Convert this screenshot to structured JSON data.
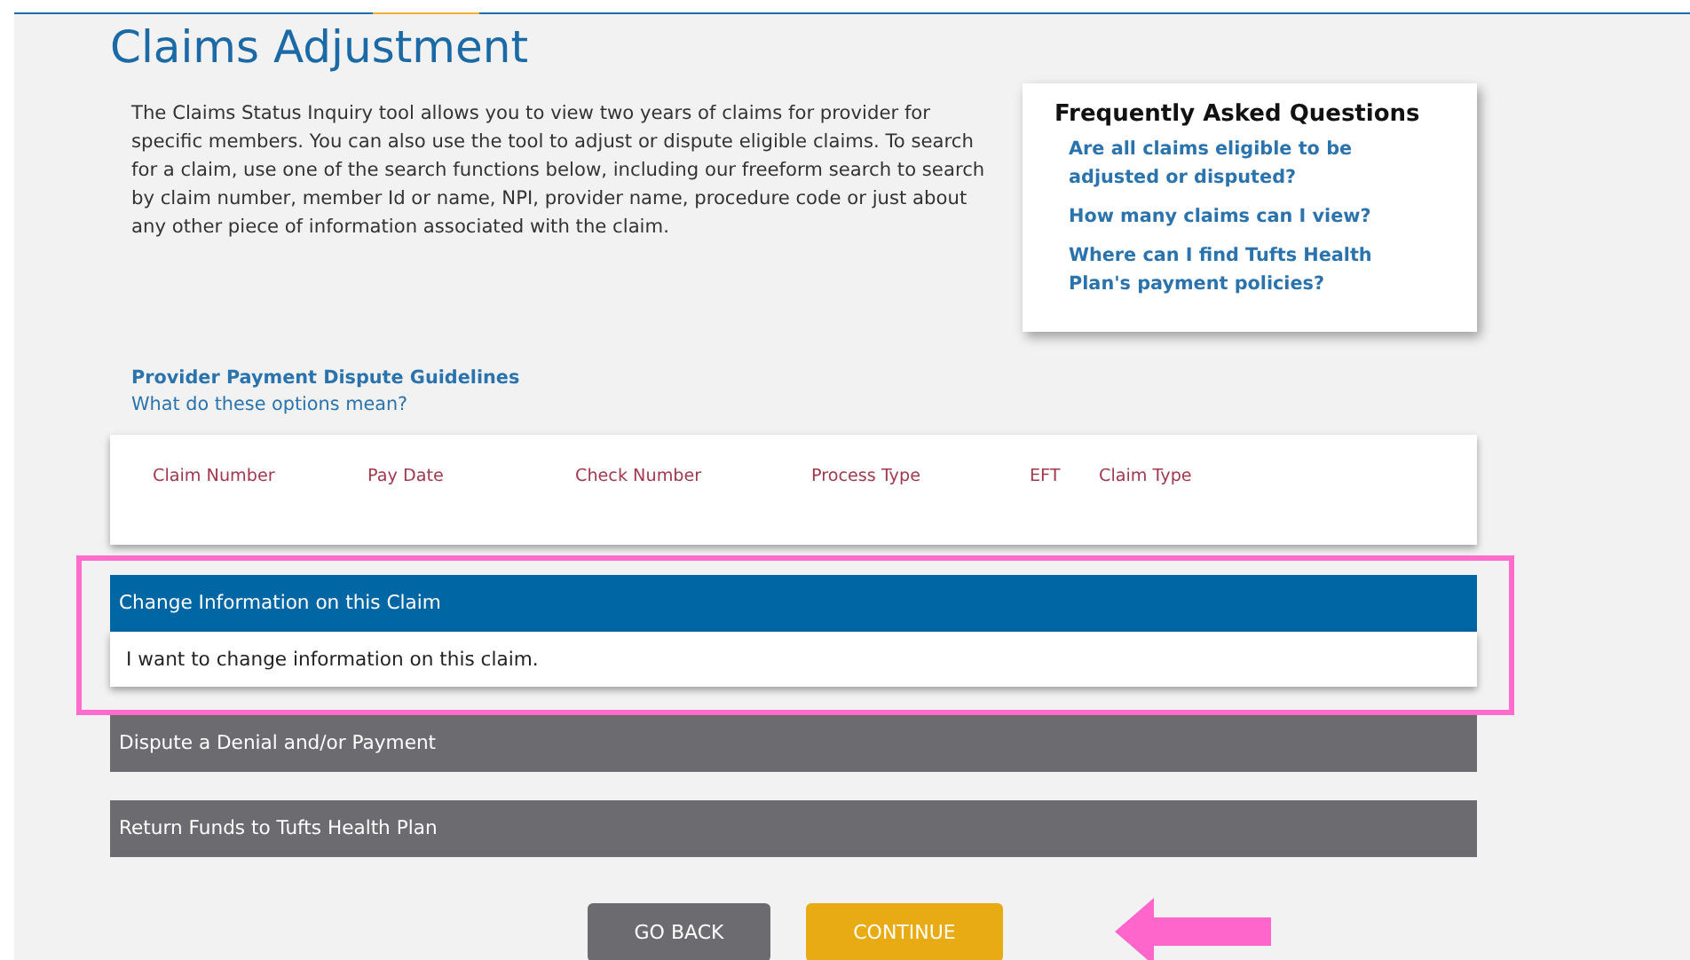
{
  "title": "Claims Adjustment",
  "intro": "The Claims Status Inquiry tool allows you to view two years of claims for provider for specific members. You can also use the tool to adjust or dispute eligible claims. To search for a claim, use one of the search functions below, including our freeform search to search by claim number, member Id or name, NPI, provider name, procedure code or just about any other piece of information associated with the claim.",
  "faq": {
    "title": "Frequently Asked Questions",
    "links": [
      "Are all claims eligible to be adjusted or disputed?",
      "How many claims can I view?",
      "Where can I find Tufts Health Plan's payment policies?"
    ]
  },
  "links": [
    {
      "label": "Provider Payment Dispute Guidelines",
      "kind": "bold"
    },
    {
      "label": "What do these options mean?",
      "kind": "plain"
    }
  ],
  "table": {
    "columns": [
      "Claim Number",
      "Pay Date",
      "Check Number",
      "Process Type",
      "EFT",
      "Claim Type"
    ]
  },
  "options": [
    {
      "label": "Change Information on this Claim",
      "selected": true,
      "description": "I want to change information on this claim."
    },
    {
      "label": "Dispute a Denial and/or Payment",
      "selected": false
    },
    {
      "label": "Return Funds to Tufts Health Plan",
      "selected": false
    }
  ],
  "buttons": [
    {
      "label": "GO BACK",
      "kind": "secondary"
    },
    {
      "label": "CONTINUE",
      "kind": "primary"
    }
  ]
}
